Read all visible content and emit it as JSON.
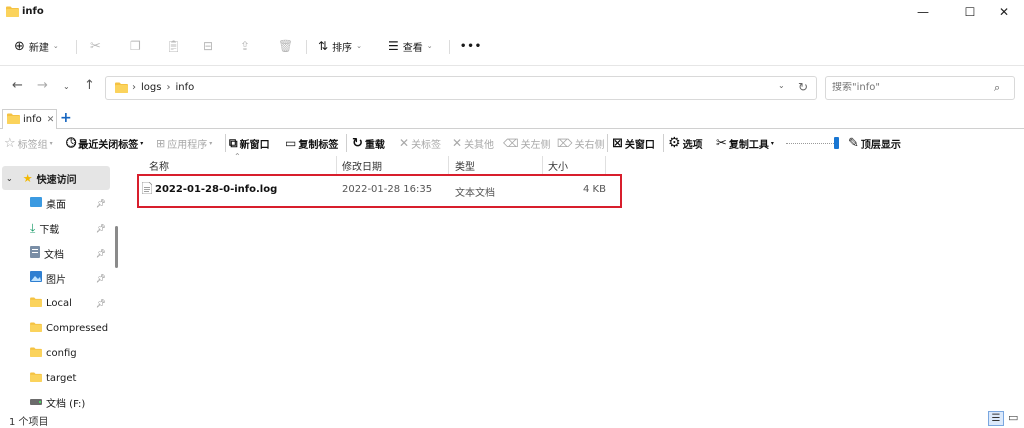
{
  "window": {
    "title": "info"
  },
  "command_bar": {
    "new_label": "新建",
    "sort_label": "排序",
    "view_label": "查看",
    "more_label": "•••"
  },
  "address": {
    "path": [
      "logs",
      "info"
    ],
    "search_placeholder": "搜索\"info\""
  },
  "tabs": [
    {
      "label": "info"
    }
  ],
  "plugin_toolbar": {
    "tab_group": "标签组",
    "recent_closed": "最近关闭标签",
    "apps": "应用程序",
    "new_window": "新窗口",
    "copy_tab": "复制标签",
    "reload": "重载",
    "close_tab": "关标签",
    "close_others": "关其他",
    "close_left": "关左侧",
    "close_right": "关右侧",
    "close_window": "关窗口",
    "options": "选项",
    "copy_tool": "复制工具",
    "pin_top": "顶层显示"
  },
  "sidebar": {
    "quick_access": "快速访问",
    "items": [
      {
        "label": "桌面",
        "pinned": true
      },
      {
        "label": "下载",
        "pinned": true
      },
      {
        "label": "文档",
        "pinned": true
      },
      {
        "label": "图片",
        "pinned": true
      },
      {
        "label": "Local",
        "pinned": true
      },
      {
        "label": "Compressed",
        "pinned": false
      },
      {
        "label": "config",
        "pinned": false
      },
      {
        "label": "target",
        "pinned": false
      },
      {
        "label": "文档 (F:)",
        "pinned": false
      }
    ]
  },
  "file_list": {
    "columns": [
      "名称",
      "修改日期",
      "类型",
      "大小"
    ],
    "rows": [
      {
        "name": "2022-01-28-0-info.log",
        "modified": "2022-01-28 16:35",
        "type": "文本文档",
        "size": "4 KB"
      }
    ]
  },
  "status_bar": {
    "item_count": "1 个项目"
  },
  "colors": {
    "accent": "#1565c0",
    "highlight": "#d81e2c",
    "folder": "#f5c242"
  }
}
